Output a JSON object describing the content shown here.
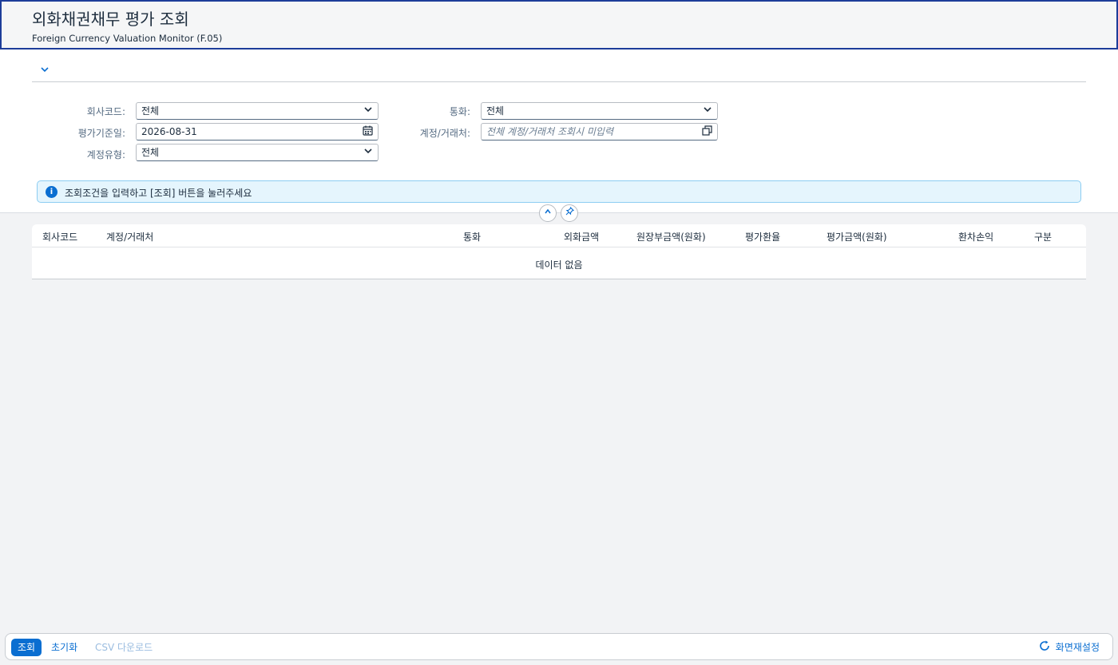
{
  "header": {
    "title": "외화채권채무 평가 조회",
    "subtitle": "Foreign Currency Valuation Monitor (F.05)"
  },
  "filters": {
    "company_code": {
      "label": "회사코드:",
      "value": "전체"
    },
    "currency": {
      "label": "통화:",
      "value": "전체"
    },
    "valuation_date": {
      "label": "평가기준일:",
      "value": "2026-08-31"
    },
    "account_partner": {
      "label": "계정/거래처:",
      "placeholder": "전체 계정/거래처 조회시 미입력"
    },
    "account_type": {
      "label": "계정유형:",
      "value": "전체"
    }
  },
  "info_message": "조회조건을 입력하고 [조회] 버튼을 눌러주세요",
  "table": {
    "columns": [
      "회사코드",
      "계정/거래처",
      "통화",
      "외화금액",
      "원장부금액(원화)",
      "평가환율",
      "평가금액(원화)",
      "환차손익",
      "구분"
    ],
    "empty_text": "데이터 없음"
  },
  "footer": {
    "search_label": "조회",
    "reset_label": "초기화",
    "csv_label": "CSV 다운로드",
    "reset_layout_label": "화면재설정"
  },
  "icons": {
    "expand": "chevron-down-icon",
    "dropdown": "chevron-down-icon",
    "calendar": "calendar-icon",
    "value_help": "value-help-icon",
    "info": "info-icon",
    "collapse": "chevron-up-icon",
    "pin": "pin-icon",
    "refresh": "refresh-icon"
  },
  "colors": {
    "accent": "#0a6ed1",
    "header_border": "#1d3d9a",
    "info_bg": "#e5f5fd"
  }
}
